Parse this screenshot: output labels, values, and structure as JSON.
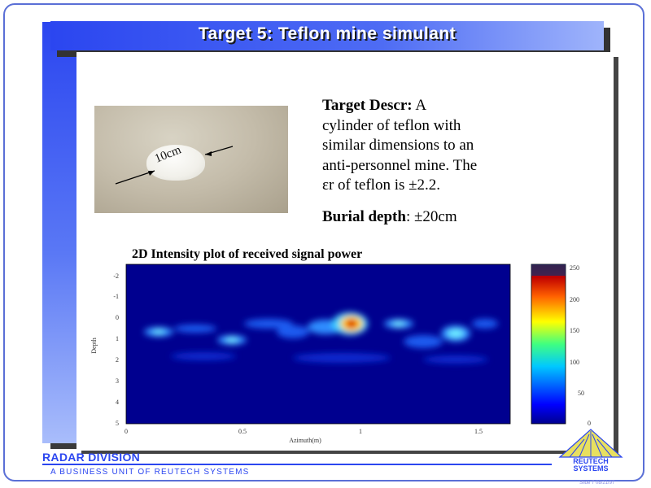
{
  "title": "Target 5: Teflon mine simulant",
  "photo": {
    "label": "10cm"
  },
  "description": {
    "heading": "Target Descr:",
    "lines": [
      "A",
      "cylinder of teflon with",
      "similar dimensions to an",
      "anti-personnel mine. The",
      "εr of teflon is ±2.2."
    ]
  },
  "burial": {
    "label": "Burial depth",
    "value": ": ±20cm"
  },
  "plot": {
    "title": "2D Intensity plot  of received signal power",
    "xlabel": "Azimuth(m)",
    "ylabel": "Depth",
    "xticks": [
      "0",
      "0.5",
      "1",
      "1.5"
    ],
    "yticks": [
      "-2",
      "-1",
      "0",
      "1",
      "2",
      "3",
      "4",
      "5"
    ],
    "colorbar_ticks": [
      "250",
      "200",
      "150",
      "100",
      "50",
      "0"
    ]
  },
  "footer": {
    "division": "RADAR DIVISION",
    "unit": "A BUSINESS UNIT OF REUTECH SYSTEMS",
    "logo_line1": "REUTECH",
    "logo_line2": "SYSTEMS",
    "slide": "Slide 7  08/21/97"
  },
  "colors": {
    "brand_blue": "#2b46f0",
    "plot_background": "#00008f"
  }
}
